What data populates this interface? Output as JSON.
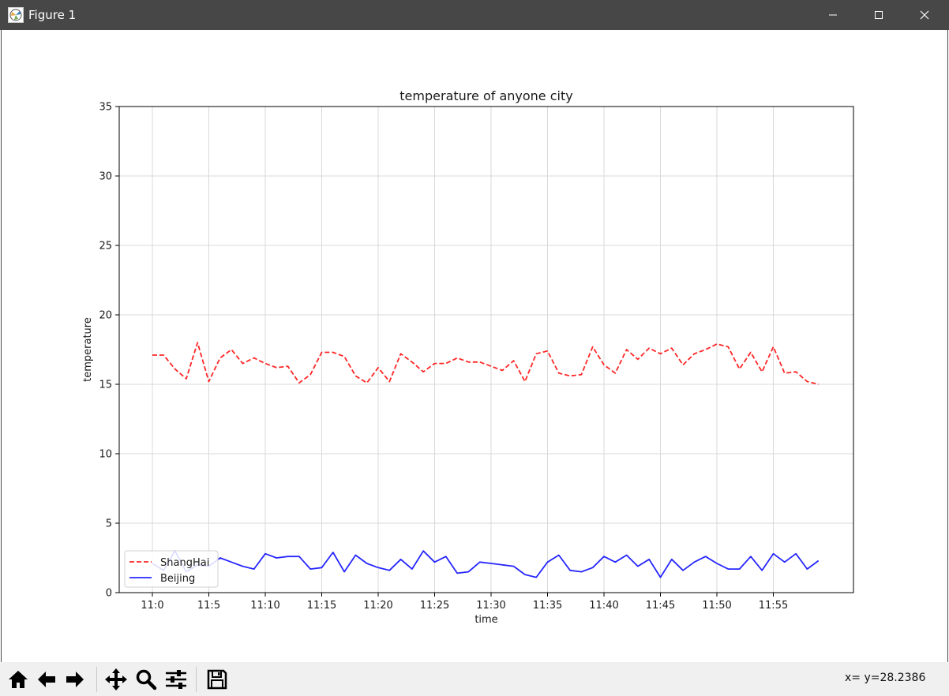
{
  "window": {
    "title": "Figure 1",
    "icon": "matplotlib-figure-icon",
    "controls": [
      "minimize-icon",
      "maximize-icon",
      "close-icon"
    ]
  },
  "toolbar": {
    "buttons": [
      "home-icon",
      "back-arrow-icon",
      "forward-arrow-icon",
      "pan-icon",
      "zoom-icon",
      "configure-subplots-icon",
      "save-icon"
    ],
    "coordinates": "x= y=28.2386"
  },
  "chart_data": {
    "type": "line",
    "title": "temperature of anyone city",
    "xlabel": "time",
    "ylabel": "temperature",
    "x": [
      "11:0",
      "11:1",
      "11:2",
      "11:3",
      "11:4",
      "11:5",
      "11:6",
      "11:7",
      "11:8",
      "11:9",
      "11:10",
      "11:11",
      "11:12",
      "11:13",
      "11:14",
      "11:15",
      "11:16",
      "11:17",
      "11:18",
      "11:19",
      "11:20",
      "11:21",
      "11:22",
      "11:23",
      "11:24",
      "11:25",
      "11:26",
      "11:27",
      "11:28",
      "11:29",
      "11:30",
      "11:31",
      "11:32",
      "11:33",
      "11:34",
      "11:35",
      "11:36",
      "11:37",
      "11:38",
      "11:39",
      "11:40",
      "11:41",
      "11:42",
      "11:43",
      "11:44",
      "11:45",
      "11:46",
      "11:47",
      "11:48",
      "11:49",
      "11:50",
      "11:51",
      "11:52",
      "11:53",
      "11:54",
      "11:55",
      "11:56",
      "11:57",
      "11:58",
      "11:59"
    ],
    "xticks": [
      "11:0",
      "11:5",
      "11:10",
      "11:15",
      "11:20",
      "11:25",
      "11:30",
      "11:35",
      "11:40",
      "11:45",
      "11:50",
      "11:55"
    ],
    "yticks": [
      0,
      5,
      10,
      15,
      20,
      25,
      30,
      35
    ],
    "ylim": [
      0,
      35
    ],
    "grid": true,
    "legend_position": "lower-left",
    "series": [
      {
        "name": "ShangHai",
        "color": "#ff0000",
        "style": "dashed",
        "values": [
          17.1,
          17.1,
          16.1,
          15.4,
          18.0,
          15.2,
          16.9,
          17.5,
          16.5,
          16.9,
          16.5,
          16.2,
          16.3,
          15.1,
          15.7,
          17.3,
          17.3,
          17.0,
          15.6,
          15.1,
          16.2,
          15.2,
          17.2,
          16.6,
          15.9,
          16.5,
          16.5,
          16.9,
          16.6,
          16.6,
          16.3,
          16.0,
          16.7,
          15.2,
          17.2,
          17.4,
          15.8,
          15.6,
          15.7,
          17.7,
          16.4,
          15.8,
          17.5,
          16.8,
          17.6,
          17.2,
          17.6,
          16.4,
          17.2,
          17.5,
          17.9,
          17.7,
          16.1,
          17.3,
          15.9,
          17.7,
          15.8,
          15.9,
          15.2,
          15.0
        ]
      },
      {
        "name": "Beijing",
        "color": "#0000ff",
        "style": "solid",
        "values": [
          2.1,
          1.6,
          3.0,
          1.5,
          2.0,
          1.9,
          2.5,
          2.2,
          1.9,
          1.7,
          2.8,
          2.5,
          2.6,
          2.6,
          1.7,
          1.8,
          2.9,
          1.5,
          2.7,
          2.1,
          1.8,
          1.6,
          2.4,
          1.7,
          3.0,
          2.2,
          2.6,
          1.4,
          1.5,
          2.2,
          2.1,
          2.0,
          1.9,
          1.3,
          1.1,
          2.2,
          2.7,
          1.6,
          1.5,
          1.8,
          2.6,
          2.2,
          2.7,
          1.9,
          2.4,
          1.1,
          2.4,
          1.6,
          2.2,
          2.6,
          2.1,
          1.7,
          1.7,
          2.6,
          1.6,
          2.8,
          2.2,
          2.8,
          1.7,
          2.3
        ]
      }
    ]
  }
}
